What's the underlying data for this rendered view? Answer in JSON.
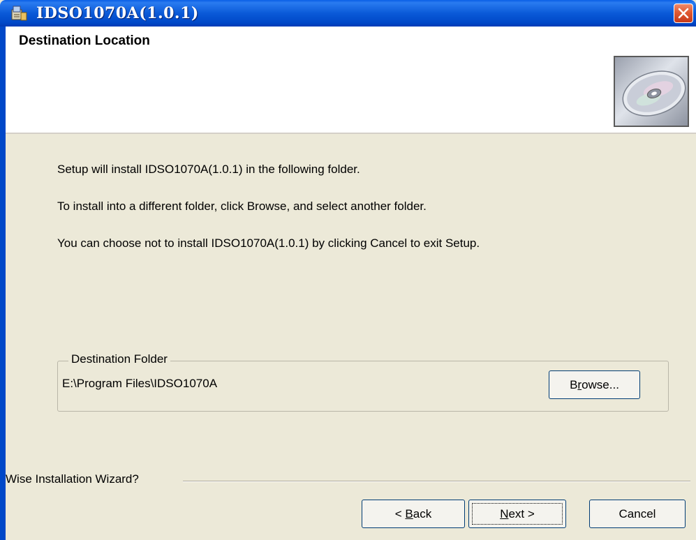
{
  "window": {
    "title": "IDSO1070A(1.0.1)",
    "title_color": "#ffffff",
    "titlebar_color": "#0a5ad8",
    "close_color": "#e05a33"
  },
  "header": {
    "title": "Destination Location"
  },
  "body": {
    "line1": "Setup will install IDSO1070A(1.0.1) in the following folder.",
    "line2": "To install into a different folder, click Browse, and select another folder.",
    "line3": "You can choose not to install IDSO1070A(1.0.1) by clicking Cancel to exit Setup."
  },
  "destination": {
    "group_label": "Destination Folder",
    "path": "E:\\Program Files\\IDSO1070A",
    "browse_prefix": "B",
    "browse_mnemonic": "r",
    "browse_suffix": "owse..."
  },
  "footer": {
    "wizard_label": "Wise Installation Wizard?",
    "back_prefix": "< ",
    "back_mnemonic": "B",
    "back_suffix": "ack",
    "next_mnemonic": "N",
    "next_suffix": "ext >",
    "cancel_label": "Cancel"
  },
  "icons": {
    "app": "installer-icon",
    "close": "close-icon",
    "cd": "cd-disc-icon"
  }
}
